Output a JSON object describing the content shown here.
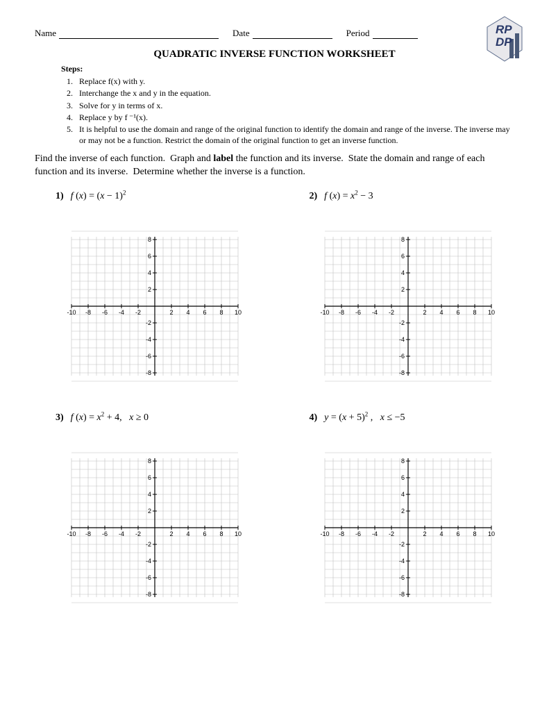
{
  "header": {
    "name_label": "Name",
    "date_label": "Date",
    "period_label": "Period"
  },
  "title": "QUADRATIC INVERSE FUNCTION WORKSHEET",
  "steps_heading": "Steps:",
  "steps": [
    "Replace f(x) with y.",
    "Interchange the x and y in the equation.",
    "Solve for y in terms of x.",
    "Replace y by f ⁻¹(x).",
    "It is helpful to use the domain and range of the original function to identify the domain and range of the inverse.  The inverse may or may not be a function.  Restrict the domain of the original function to get an inverse function."
  ],
  "instructions": "Find the inverse of each function.  Graph and label the function and its inverse.  State the domain and range of each function and its inverse.  Determine whether the inverse is a function.",
  "problems": [
    {
      "num": "1)",
      "formula_html": "<span class='math-i'>f</span> (<span class='math-i'>x</span>) = (<span class='math-i'>x</span> − 1)<span class='sup'>2</span>"
    },
    {
      "num": "2)",
      "formula_html": "<span class='math-i'>f</span> (<span class='math-i'>x</span>) = <span class='math-i'>x</span><span class='sup'>2</span> − 3"
    },
    {
      "num": "3)",
      "formula_html": "<span class='math-i'>f</span> (<span class='math-i'>x</span>) = <span class='math-i'>x</span><span class='sup'>2</span> + 4, &nbsp;&nbsp;<span class='math-i'>x</span> ≥ 0"
    },
    {
      "num": "4)",
      "formula_html": "<span class='math-i'>y</span> = (<span class='math-i'>x</span> + 5)<span class='sup'>2</span> , &nbsp;&nbsp;<span class='math-i'>x</span> ≤ −5"
    }
  ],
  "axis": {
    "ticks": [
      -10,
      -8,
      -6,
      -4,
      -2,
      2,
      4,
      6,
      8,
      10
    ]
  },
  "logo": {
    "text_top": "RP",
    "text_bottom": "DP"
  }
}
